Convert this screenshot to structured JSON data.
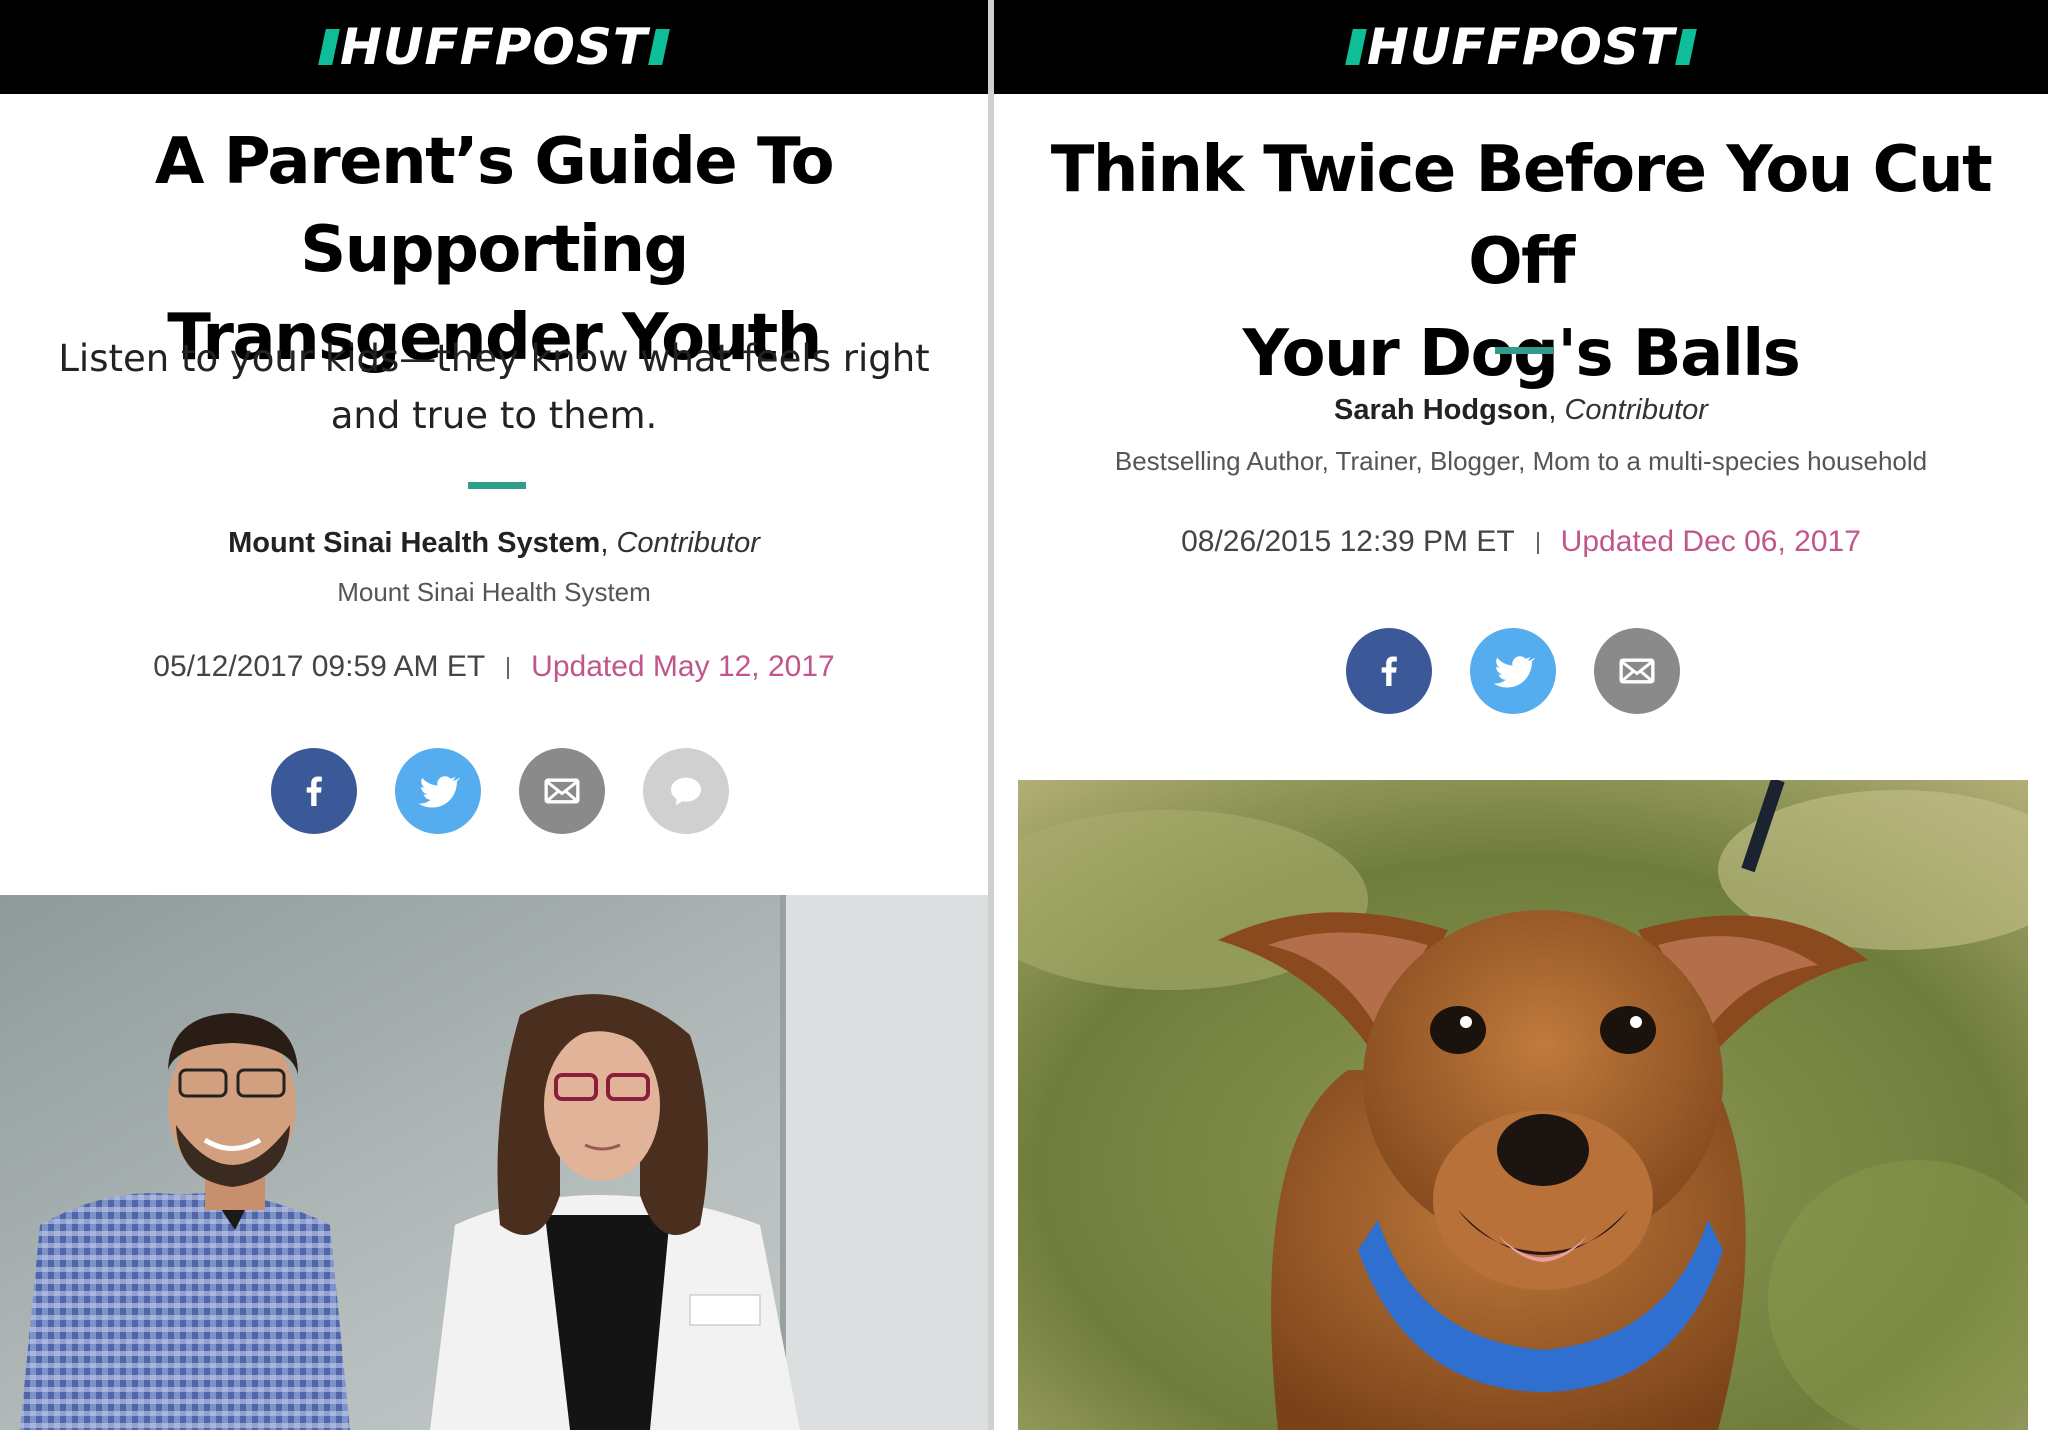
{
  "left": {
    "brand": "HUFFPOST",
    "headline_line1": "A Parent’s Guide To Supporting",
    "headline_line2": "Transgender Youth",
    "dek_line1": "Listen to your kids—they know what feels right",
    "dek_line2": "and true to them.",
    "author": "Mount Sinai Health System",
    "role": "Contributor",
    "affiliation": "Mount Sinai Health System",
    "published": "05/12/2017 09:59 AM ET",
    "updated_label": "Updated May 12, 2017",
    "share": [
      "facebook-icon",
      "twitter-icon",
      "email-icon",
      "comment-icon"
    ],
    "photo": "two clinicians, a man in a checked shirt and a woman in a white coat"
  },
  "right": {
    "brand": "HUFFPOST",
    "headline_line1": "Think Twice Before You Cut Off",
    "headline_line2": "Your Dog's Balls",
    "author": "Sarah Hodgson",
    "role": "Contributor",
    "affiliation": "Bestselling Author, Trainer, Blogger, Mom to a multi-species household",
    "published": "08/26/2015 12:39 PM ET",
    "updated_label": "Updated Dec 06, 2017",
    "share": [
      "facebook-icon",
      "twitter-icon",
      "email-icon"
    ],
    "photo": "brown dog with blue collar on grass"
  },
  "colors": {
    "bar": "#000000",
    "logo_accent": "#0dbe98",
    "rule": "#2e9e8a",
    "updated": "#c0568a",
    "facebook": "#3b5998",
    "twitter": "#55acee",
    "email": "#8a8a8a",
    "comment": "#d0d0d0"
  }
}
